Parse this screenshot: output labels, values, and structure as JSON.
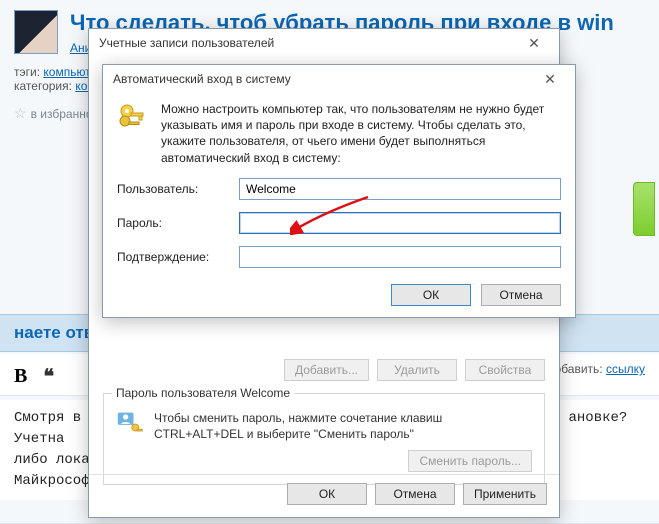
{
  "question": {
    "title": "Что сделать, чтоб убрать пароль при входе в win",
    "author_link": "Аникс [",
    "tags_label": "тэги:",
    "tags_link": "компьютер,",
    "category_label": "категория:",
    "category_link": "компь",
    "fav_star": "☆",
    "fav_label": "в избранное"
  },
  "answer_bar": "наете ответ",
  "toolbar": {
    "bold": "B",
    "quote": "❝❝"
  },
  "add_link": {
    "prefix": "добавить:",
    "link": "ссылку"
  },
  "answer_body": "Смотря в ка                                                       ановке? Учетна\nлибо локальн\nМайкрософт",
  "users_dialog": {
    "title": "Учетные записи пользователей",
    "btn_add": "Добавить...",
    "btn_del": "Удалить",
    "btn_props": "Свойства",
    "group_title": "Пароль пользователя Welcome",
    "group_text": "Чтобы сменить пароль, нажмите сочетание клавиш CTRL+ALT+DEL и выберите \"Сменить пароль\"",
    "btn_change": "Сменить пароль...",
    "ok": "ОК",
    "cancel": "Отмена",
    "apply": "Применить"
  },
  "auto_dialog": {
    "title": "Автоматический вход в систему",
    "desc": "Можно настроить компьютер так, что пользователям не нужно будет указывать имя и пароль при входе в систему. Чтобы сделать это, укажите пользователя, от чьего имени будет выполняться автоматический вход в систему:",
    "user_label": "Пользователь:",
    "user_value": "Welcome",
    "pwd_label": "Пароль:",
    "pwd_value": "",
    "confirm_label": "Подтверждение:",
    "confirm_value": "",
    "ok": "ОК",
    "cancel": "Отмена"
  }
}
